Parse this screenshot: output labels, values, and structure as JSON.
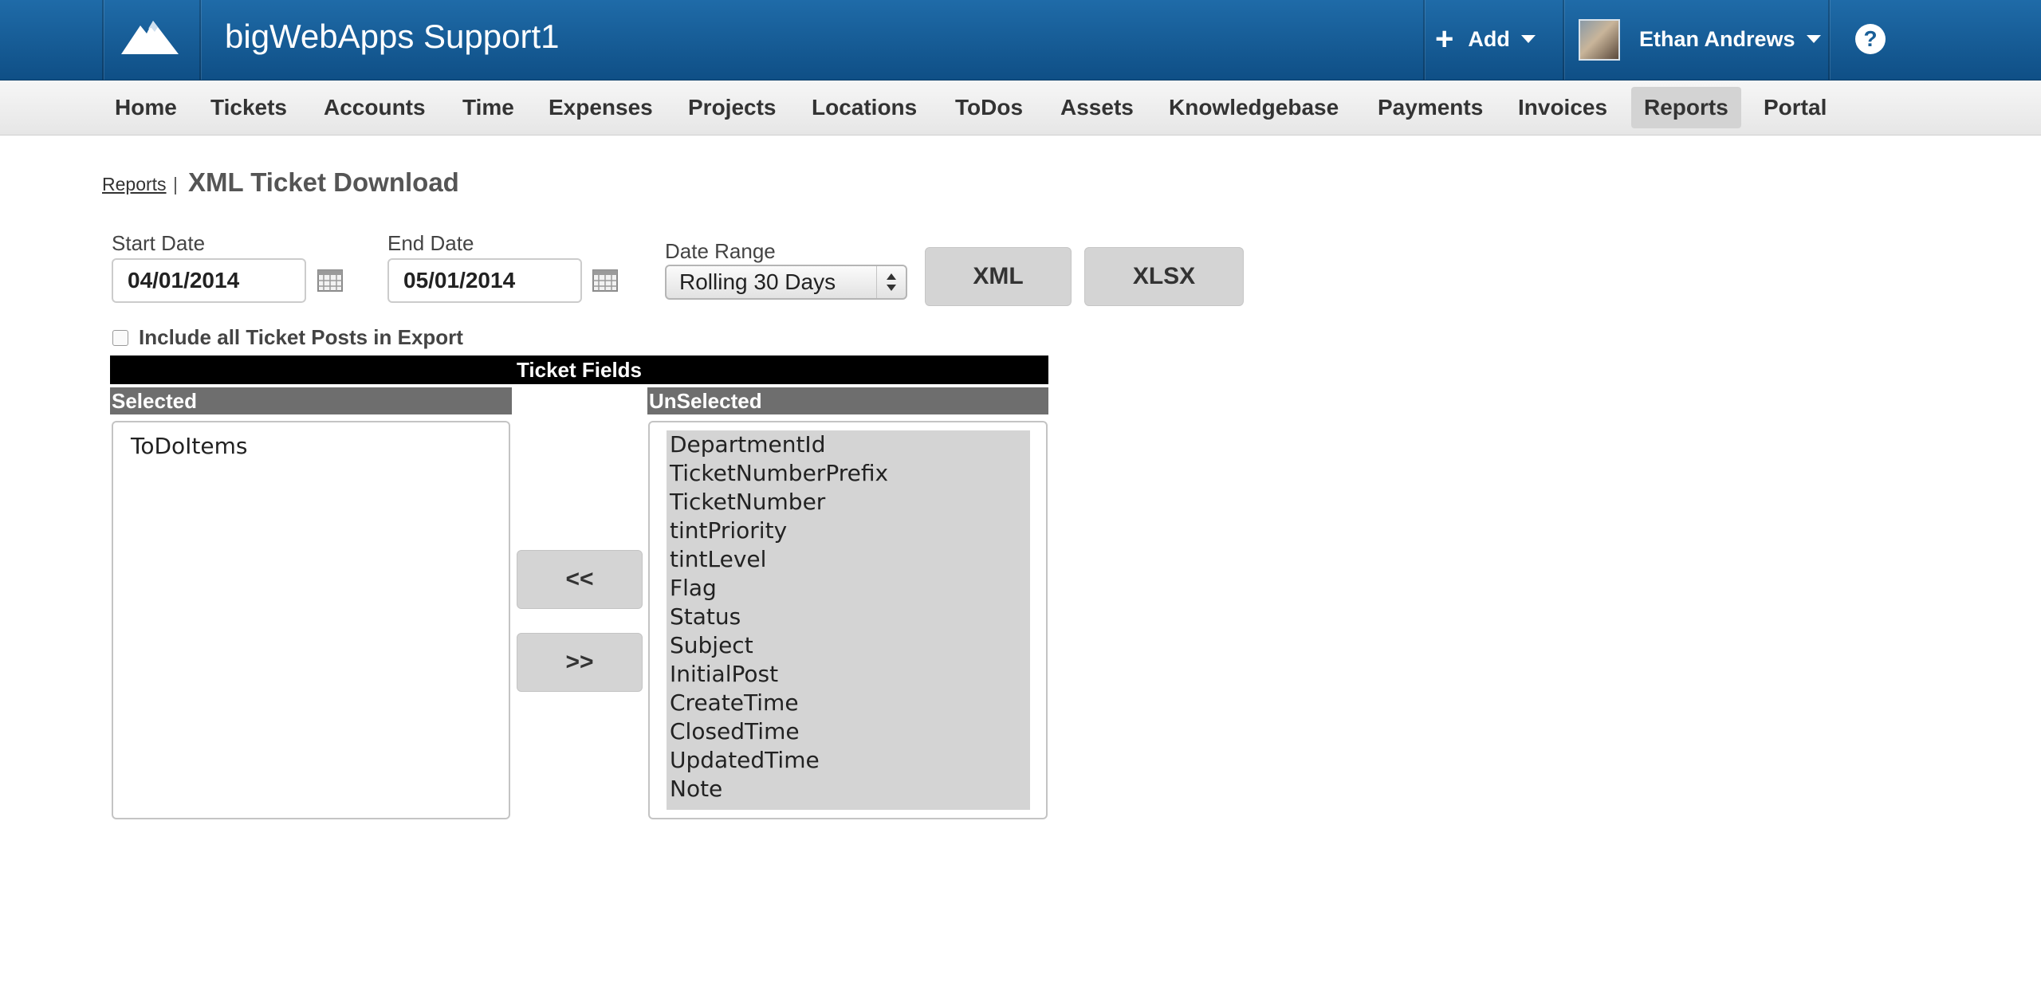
{
  "header": {
    "app_title": "bigWebApps Support1",
    "add_label": "Add",
    "user_name": "Ethan Andrews",
    "help_label": "?"
  },
  "nav": {
    "items": [
      "Home",
      "Tickets",
      "Accounts",
      "Time",
      "Expenses",
      "Projects",
      "Locations",
      "ToDos",
      "Assets",
      "Knowledgebase",
      "Payments",
      "Invoices",
      "Reports",
      "Portal"
    ],
    "active": "Reports"
  },
  "breadcrumb": {
    "parent": "Reports",
    "separator": "|",
    "title": "XML Ticket Download"
  },
  "form": {
    "start_date_label": "Start Date",
    "start_date_value": "04/01/2014",
    "end_date_label": "End Date",
    "end_date_value": "05/01/2014",
    "date_range_label": "Date Range",
    "date_range_value": "Rolling 30 Days",
    "xml_button": "XML",
    "xlsx_button": "XLSX",
    "include_posts_label": "Include all Ticket Posts in Export",
    "include_posts_checked": false
  },
  "ticket_fields": {
    "header": "Ticket Fields",
    "selected_header": "Selected",
    "unselected_header": "UnSelected",
    "selected_items": [
      "ToDoItems"
    ],
    "unselected_items": [
      "DepartmentId",
      "TicketNumberPrefix",
      "TicketNumber",
      "tintPriority",
      "tintLevel",
      "Flag",
      "Status",
      "Subject",
      "InitialPost",
      "CreateTime",
      "ClosedTime",
      "UpdatedTime",
      "Note"
    ],
    "move_left_label": "<<",
    "move_right_label": ">>"
  },
  "colors": {
    "header_top": "#1f6ba8",
    "header_bottom": "#0f4f86",
    "nav_active": "#d3d3d3",
    "button_gray": "#d4d4d4",
    "column_header": "#6e6e6e"
  },
  "icons": [
    "mountain-logo-icon",
    "plus-icon",
    "caret-down-icon",
    "help-icon",
    "calendar-icon",
    "select-arrows-icon"
  ]
}
